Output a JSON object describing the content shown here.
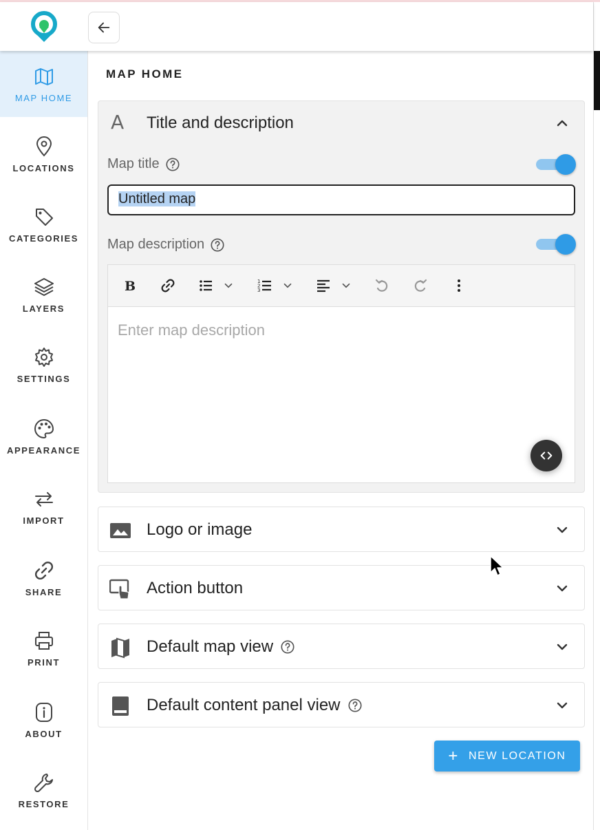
{
  "sidebar": {
    "items": [
      {
        "label": "MAP HOME",
        "icon": "map-icon",
        "active": true
      },
      {
        "label": "LOCATIONS",
        "icon": "location-pin-icon"
      },
      {
        "label": "CATEGORIES",
        "icon": "tag-icon"
      },
      {
        "label": "LAYERS",
        "icon": "layers-icon"
      },
      {
        "label": "SETTINGS",
        "icon": "gear-icon"
      },
      {
        "label": "APPEARANCE",
        "icon": "palette-icon"
      },
      {
        "label": "IMPORT",
        "icon": "swap-arrows-icon"
      },
      {
        "label": "SHARE",
        "icon": "link-icon"
      },
      {
        "label": "PRINT",
        "icon": "printer-icon"
      },
      {
        "label": "ABOUT",
        "icon": "info-icon"
      },
      {
        "label": "RESTORE",
        "icon": "wrench-icon"
      }
    ]
  },
  "page": {
    "title": "MAP HOME"
  },
  "title_panel": {
    "title": "Title and description",
    "map_title_label": "Map title",
    "map_title_value": "Untitled map",
    "map_title_enabled": true,
    "map_description_label": "Map description",
    "map_description_enabled": true,
    "description_placeholder": "Enter map description"
  },
  "panels": [
    {
      "title": "Logo or image",
      "icon": "image-icon",
      "help": false
    },
    {
      "title": "Action button",
      "icon": "touch-screen-icon",
      "help": false
    },
    {
      "title": "Default map view",
      "icon": "map-icon",
      "help": true
    },
    {
      "title": "Default content panel view",
      "icon": "panel-icon",
      "help": true
    }
  ],
  "new_location_button": {
    "label": "NEW LOCATION"
  },
  "colors": {
    "accent": "#2f9be6",
    "active_bg": "#e3f0fb",
    "logo_teal": "#17a9c9",
    "logo_green": "#2fc36a"
  }
}
